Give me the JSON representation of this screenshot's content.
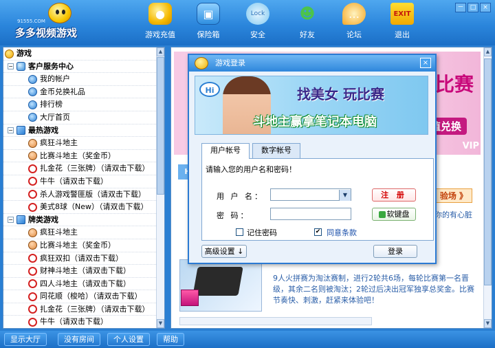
{
  "header": {
    "logo_domain": "91555.COM",
    "logo_text": "多多视频游戏",
    "nav": [
      {
        "label": "游戏充值",
        "icon": "coins-icon",
        "color": "#f5b800"
      },
      {
        "label": "保险箱",
        "icon": "safe-icon",
        "color": "#3fa0e8"
      },
      {
        "label": "安全",
        "icon": "lock-icon",
        "color": "#7fc8f0"
      },
      {
        "label": "好友",
        "icon": "friends-icon",
        "color": "#4cc34c"
      },
      {
        "label": "论坛",
        "icon": "forum-icon",
        "color": "#f5a623"
      },
      {
        "label": "退出",
        "icon": "exit-icon",
        "color": "#e03a1a"
      }
    ],
    "window_buttons": [
      "－",
      "□",
      "×"
    ]
  },
  "tree": {
    "root": "游戏",
    "categories": [
      {
        "label": "客户服务中心",
        "expand": "−",
        "items": [
          "我的帐户",
          "金币兑换礼品",
          "排行榜",
          "大厅首页"
        ]
      },
      {
        "label": "最热游戏",
        "expand": "−",
        "items": [
          "疯狂斗地主",
          "比赛斗地主（奖金币）",
          "扎金花（三张牌）（请双击下载）",
          "牛牛（请双击下载）",
          "杀人游戏警匪版（请双击下载）",
          "美式8球（New）（请双击下载）"
        ]
      },
      {
        "label": "牌类游戏",
        "expand": "−",
        "items": [
          "疯狂斗地主",
          "比赛斗地主（奖金币）",
          "疯狂双扣（请双击下载）",
          "财神斗地主（请双击下载）",
          "四人斗地主（请双击下载）",
          "同花顺（梭哈）（请双击下载）",
          "扎金花（三张牌）（请双击下载）",
          "牛牛（请双击下载）"
        ]
      }
    ]
  },
  "bottom_bar": {
    "buttons": [
      "显示大厅",
      "没有房间",
      "个人设置",
      "帮助"
    ]
  },
  "background_content": {
    "banner_text": "玩比赛",
    "banner_sub": "值兑换",
    "banner_corner": "VIP",
    "tag": "H",
    "more_link": "验场 》",
    "side_text": "。结合你的有心脏病、",
    "description": "9人火拼赛为淘汰赛制，进行2轮共6场，每轮比赛第一名晋级，其余二名则被淘汰；2轮过后决出冠军独享总奖金。比赛节奏快、刺激，赶紧来体验吧！"
  },
  "dialog": {
    "title": "游戏登录",
    "close": "×",
    "banner": {
      "hi": "Hi",
      "line1": "找美女 玩比赛",
      "line2": "斗地主赢拿笔记本电脑"
    },
    "tabs": [
      "用户帐号",
      "数字帐号"
    ],
    "prompt": "请输入您的用户名和密码！",
    "username_label": "用 户 名：",
    "password_label": "密    码：",
    "username_value": "",
    "password_value": "",
    "register_button": "注 册",
    "keyboard_button": "软键盘",
    "remember_label": "记住密码",
    "remember_checked": false,
    "agree_label": "同意条款",
    "agree_checked": true,
    "advanced_button": "高级设置 ↓",
    "login_button": "登录"
  }
}
